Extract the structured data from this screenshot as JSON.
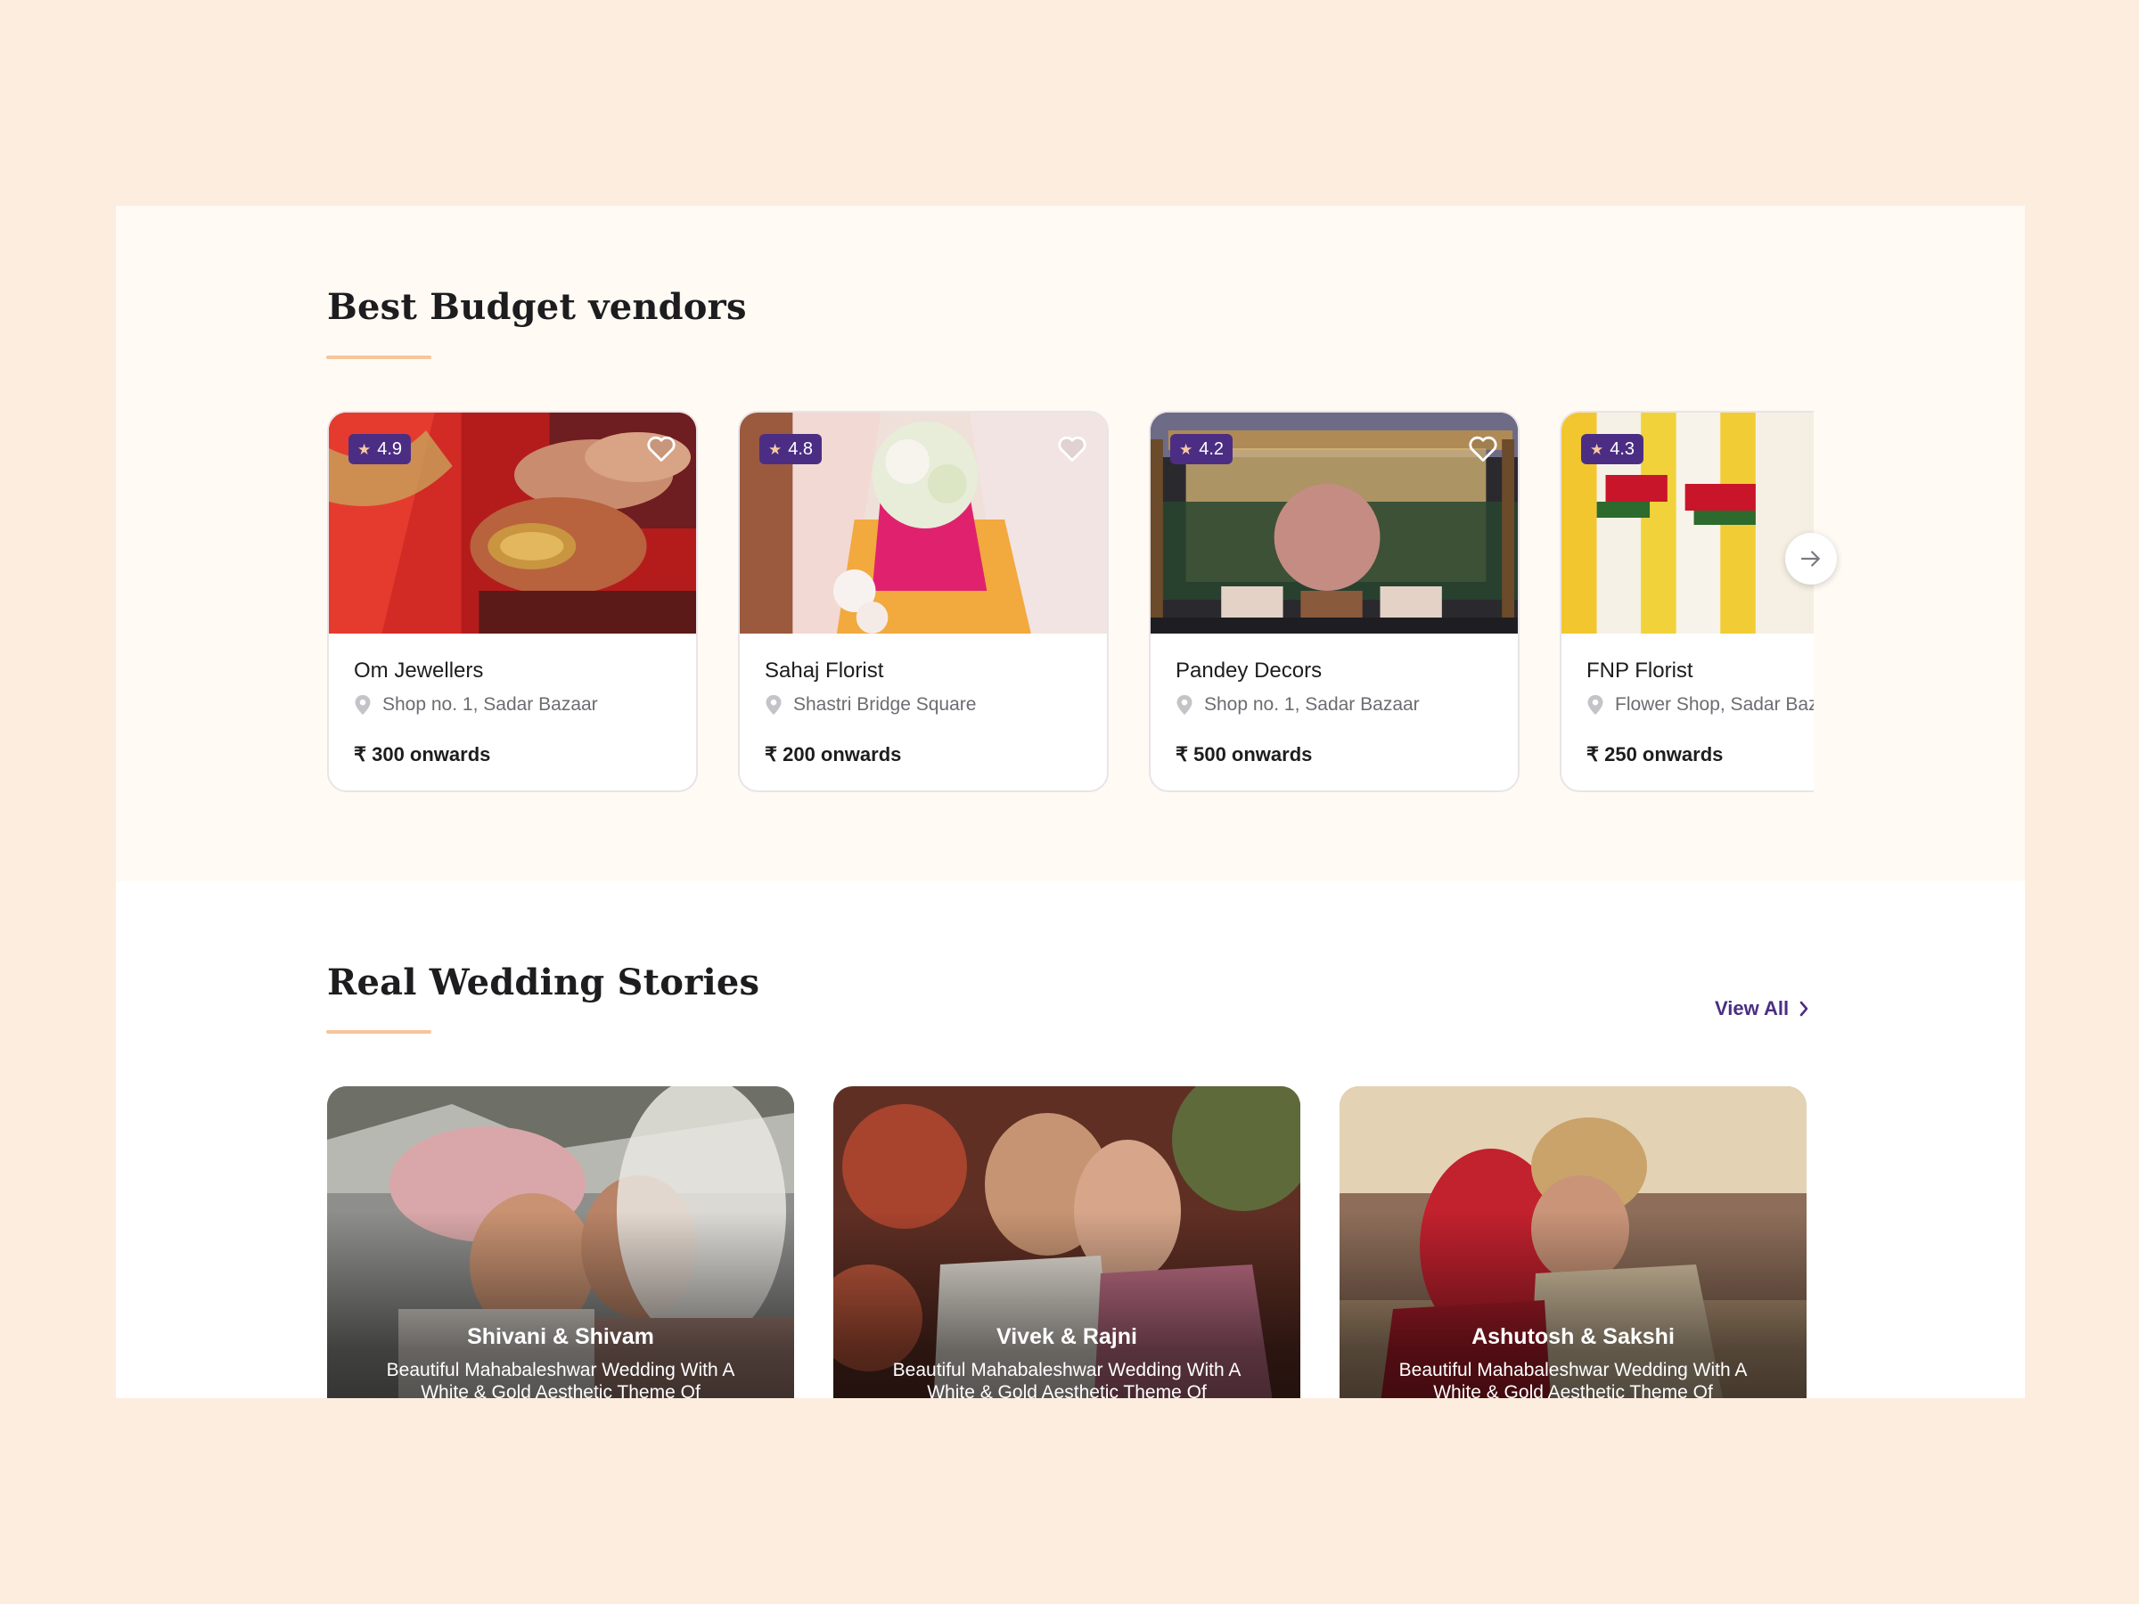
{
  "vendors_section": {
    "title": "Best Budget vendors",
    "vendors": [
      {
        "rating": "4.9",
        "name": "Om Jewellers",
        "address": "Shop no. 1, Sadar Bazaar",
        "price": "₹ 300 onwards"
      },
      {
        "rating": "4.8",
        "name": "Sahaj Florist",
        "address": "Shastri Bridge Square",
        "price": "₹ 200 onwards"
      },
      {
        "rating": "4.2",
        "name": "Pandey Decors",
        "address": "Shop no. 1, Sadar Bazaar",
        "price": "₹ 500 onwards"
      },
      {
        "rating": "4.3",
        "name": "FNP Florist",
        "address": "Flower Shop, Sadar Bazaar",
        "price": "₹ 250 onwards"
      }
    ]
  },
  "stories_section": {
    "title": "Real Wedding Stories",
    "view_all_label": "View All",
    "stories": [
      {
        "couple": "Shivani & Shivam",
        "description": "Beautiful Mahabaleshwar Wedding With A White & Gold Aesthetic Theme Of"
      },
      {
        "couple": "Vivek & Rajni",
        "description": "Beautiful Mahabaleshwar Wedding With A White & Gold Aesthetic Theme Of"
      },
      {
        "couple": "Ashutosh & Sakshi",
        "description": "Beautiful Mahabaleshwar Wedding With A White & Gold Aesthetic Theme Of"
      }
    ]
  },
  "colors": {
    "page_background": "#FDEDDE",
    "section_background": "#FFFAF4",
    "accent_purple": "#4B2E83",
    "underline_peach": "#F5C59B"
  },
  "icons": {
    "rating": "star-icon",
    "favorite": "heart-icon",
    "location": "map-pin-icon",
    "carousel_next": "arrow-right-icon",
    "view_all": "chevron-right-icon"
  }
}
